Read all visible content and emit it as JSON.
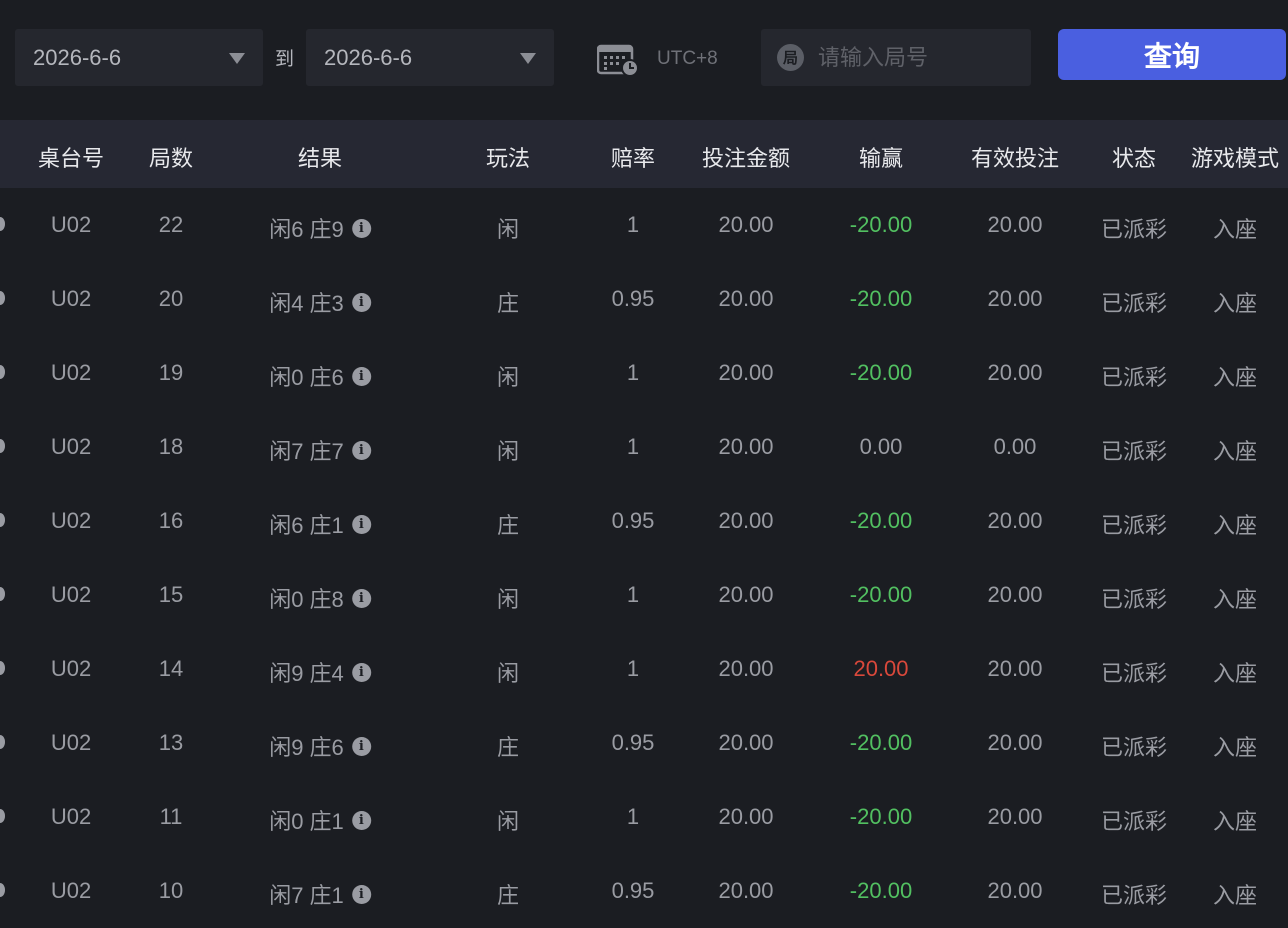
{
  "filters": {
    "date_from": "2026-6-6",
    "to_label": "到",
    "date_to": "2026-6-6",
    "timezone": "UTC+8",
    "round_badge": "局",
    "round_placeholder": "请输入局号",
    "query_label": "查询"
  },
  "colors": {
    "accent": "#4a5fe0",
    "negative": "#52c061",
    "positive": "#d9483b"
  },
  "table": {
    "headers": [
      "桌台号",
      "局数",
      "结果",
      "玩法",
      "赔率",
      "投注金额",
      "输赢",
      "有效投注",
      "状态",
      "游戏模式"
    ],
    "rows": [
      {
        "table": "U02",
        "round": "22",
        "result": "闲6 庄9",
        "play": "闲",
        "odds": "1",
        "bet": "20.00",
        "winloss": "-20.00",
        "valid": "20.00",
        "status": "已派彩",
        "mode": "入座"
      },
      {
        "table": "U02",
        "round": "20",
        "result": "闲4 庄3",
        "play": "庄",
        "odds": "0.95",
        "bet": "20.00",
        "winloss": "-20.00",
        "valid": "20.00",
        "status": "已派彩",
        "mode": "入座"
      },
      {
        "table": "U02",
        "round": "19",
        "result": "闲0 庄6",
        "play": "闲",
        "odds": "1",
        "bet": "20.00",
        "winloss": "-20.00",
        "valid": "20.00",
        "status": "已派彩",
        "mode": "入座"
      },
      {
        "table": "U02",
        "round": "18",
        "result": "闲7 庄7",
        "play": "闲",
        "odds": "1",
        "bet": "20.00",
        "winloss": "0.00",
        "valid": "0.00",
        "status": "已派彩",
        "mode": "入座"
      },
      {
        "table": "U02",
        "round": "16",
        "result": "闲6 庄1",
        "play": "庄",
        "odds": "0.95",
        "bet": "20.00",
        "winloss": "-20.00",
        "valid": "20.00",
        "status": "已派彩",
        "mode": "入座"
      },
      {
        "table": "U02",
        "round": "15",
        "result": "闲0 庄8",
        "play": "闲",
        "odds": "1",
        "bet": "20.00",
        "winloss": "-20.00",
        "valid": "20.00",
        "status": "已派彩",
        "mode": "入座"
      },
      {
        "table": "U02",
        "round": "14",
        "result": "闲9 庄4",
        "play": "闲",
        "odds": "1",
        "bet": "20.00",
        "winloss": "20.00",
        "valid": "20.00",
        "status": "已派彩",
        "mode": "入座"
      },
      {
        "table": "U02",
        "round": "13",
        "result": "闲9 庄6",
        "play": "庄",
        "odds": "0.95",
        "bet": "20.00",
        "winloss": "-20.00",
        "valid": "20.00",
        "status": "已派彩",
        "mode": "入座"
      },
      {
        "table": "U02",
        "round": "11",
        "result": "闲0 庄1",
        "play": "闲",
        "odds": "1",
        "bet": "20.00",
        "winloss": "-20.00",
        "valid": "20.00",
        "status": "已派彩",
        "mode": "入座"
      },
      {
        "table": "U02",
        "round": "10",
        "result": "闲7 庄1",
        "play": "庄",
        "odds": "0.95",
        "bet": "20.00",
        "winloss": "-20.00",
        "valid": "20.00",
        "status": "已派彩",
        "mode": "入座"
      }
    ]
  },
  "icons": {
    "calendar": "calendar-clock-icon",
    "caret": "chevron-down-icon",
    "info": "info-icon"
  }
}
